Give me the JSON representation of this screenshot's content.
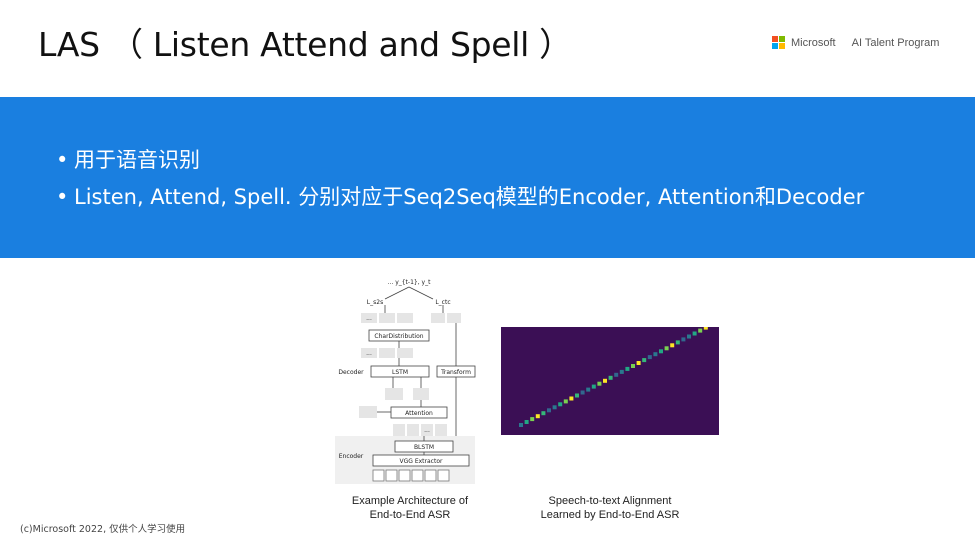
{
  "title": "LAS （ Listen Attend and Spell ）",
  "brand": {
    "company": "Microsoft",
    "program": "AI Talent Program",
    "logo_colors": [
      "#f25022",
      "#7fba00",
      "#00a4ef",
      "#ffb900"
    ]
  },
  "colors": {
    "band": "#1a7fe0",
    "heatmap_bg": "#3b0f55"
  },
  "bullets": [
    "用于语音识别",
    "Listen, Attend, Spell. 分别对应于Seq2Seq模型的Encoder, Attention和Decoder"
  ],
  "figure_left": {
    "caption_line1": "Example Architecture of",
    "caption_line2": "End-to-End ASR",
    "labels": {
      "top": "... y_{t-1}, y_t",
      "l_s2s": "L_s2s",
      "l_ctc": "L_ctc",
      "char_distribution": "CharDistribution",
      "decoder": "Decoder",
      "lstm": "LSTM",
      "transform": "Transform",
      "attention": "Attention",
      "encoder": "Encoder",
      "blstm": "BLSTM",
      "vgg": "VGG Extractor",
      "ellipsis": "..."
    }
  },
  "figure_right": {
    "caption_line1": "Speech-to-text Alignment",
    "caption_line2": "Learned by End-to-End ASR"
  },
  "footer": "(c)Microsoft 2022, 仅供个人学习使用"
}
